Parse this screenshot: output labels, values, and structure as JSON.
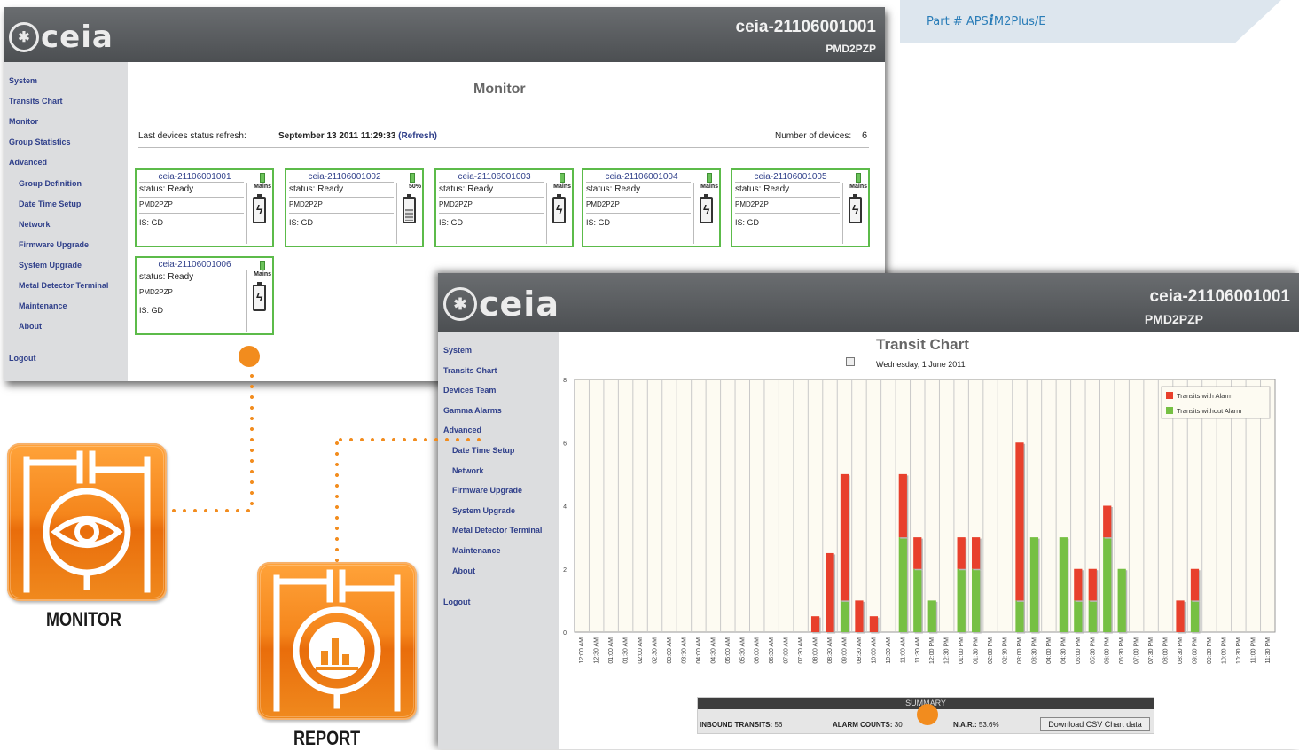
{
  "part_number": {
    "prefix": "Part # APS",
    "emphasis": "i",
    "suffix": "M2Plus/E"
  },
  "monitor_screen": {
    "brand": "ceia",
    "device_id": "ceia-21106001001",
    "model": "PMD2PZP",
    "sidebar": [
      "System",
      "Transits Chart",
      "Monitor",
      "Group Statistics",
      "Advanced",
      "Group Definition",
      "Date Time Setup",
      "Network",
      "Firmware Upgrade",
      "System Upgrade",
      "Metal Detector Terminal",
      "Maintenance",
      "About",
      "Logout"
    ],
    "title": "Monitor",
    "refresh_label": "Last devices status refresh:",
    "refresh_date": "September 13 2011 11:29:33",
    "refresh_link": "(Refresh)",
    "device_count_label": "Number of devices:",
    "device_count": "6",
    "devices": [
      {
        "name": "ceia-21106001001",
        "status": "status: Ready",
        "model": "PMD2PZP",
        "is": "IS: GD",
        "power": "Mains"
      },
      {
        "name": "ceia-21106001002",
        "status": "status: Ready",
        "model": "PMD2PZP",
        "is": "IS: GD",
        "power": "50%"
      },
      {
        "name": "ceia-21106001003",
        "status": "status: Ready",
        "model": "PMD2PZP",
        "is": "IS: GD",
        "power": "Mains"
      },
      {
        "name": "ceia-21106001004",
        "status": "status: Ready",
        "model": "PMD2PZP",
        "is": "IS: GD",
        "power": "Mains"
      },
      {
        "name": "ceia-21106001005",
        "status": "status: Ready",
        "model": "PMD2PZP",
        "is": "IS: GD",
        "power": "Mains"
      },
      {
        "name": "ceia-21106001006",
        "status": "status: Ready",
        "model": "PMD2PZP",
        "is": "IS: GD",
        "power": "Mains"
      }
    ]
  },
  "transit_screen": {
    "brand": "ceia",
    "device_id": "ceia-21106001001",
    "model": "PMD2PZP",
    "sidebar": [
      "System",
      "Transits Chart",
      "Devices Team",
      "Gamma Alarms",
      "Advanced",
      "Date Time Setup",
      "Network",
      "Firmware Upgrade",
      "System Upgrade",
      "Metal Detector Terminal",
      "Maintenance",
      "About",
      "Logout"
    ],
    "title": "Transit Chart",
    "date": "Wednesday, 1 June 2011",
    "summary": {
      "header": "SUMMARY",
      "inbound_label": "INBOUND TRANSITS:",
      "inbound_value": "56",
      "alarm_label": "ALARM COUNTS:",
      "alarm_value": "30",
      "nar_label": "N.A.R.:",
      "nar_value": "53.6%",
      "button": "Download CSV Chart data"
    }
  },
  "chart_data": {
    "type": "bar",
    "stacked": true,
    "title": "Transit Chart",
    "ylim": [
      0,
      8
    ],
    "yticks": [
      0,
      2,
      4,
      6,
      8
    ],
    "grid": true,
    "legend": "top-right",
    "colors": {
      "Transits with Alarm": "#e8402c",
      "Transits without Alarm": "#76c043"
    },
    "categories": [
      "12:00 AM",
      "12:30 AM",
      "01:00 AM",
      "01:30 AM",
      "02:00 AM",
      "02:30 AM",
      "03:00 AM",
      "03:30 AM",
      "04:00 AM",
      "04:30 AM",
      "05:00 AM",
      "05:30 AM",
      "06:00 AM",
      "06:30 AM",
      "07:00 AM",
      "07:30 AM",
      "08:00 AM",
      "08:30 AM",
      "09:00 AM",
      "09:30 AM",
      "10:00 AM",
      "10:30 AM",
      "11:00 AM",
      "11:30 AM",
      "12:00 PM",
      "12:30 PM",
      "01:00 PM",
      "01:30 PM",
      "02:00 PM",
      "02:30 PM",
      "03:00 PM",
      "03:30 PM",
      "04:00 PM",
      "04:30 PM",
      "05:00 PM",
      "05:30 PM",
      "06:00 PM",
      "06:30 PM",
      "07:00 PM",
      "07:30 PM",
      "08:00 PM",
      "08:30 PM",
      "09:00 PM",
      "09:30 PM",
      "10:00 PM",
      "10:30 PM",
      "11:00 PM",
      "11:30 PM"
    ],
    "series": [
      {
        "name": "Transits without Alarm",
        "values": [
          0,
          0,
          0,
          0,
          0,
          0,
          0,
          0,
          0,
          0,
          0,
          0,
          0,
          0,
          0,
          0,
          0,
          0,
          1,
          0,
          0,
          0,
          3,
          2,
          1,
          0,
          2,
          2,
          0,
          0,
          1,
          3,
          0,
          3,
          1,
          1,
          3,
          2,
          0,
          0,
          0,
          0,
          1,
          0,
          0,
          0,
          0,
          0
        ]
      },
      {
        "name": "Transits with Alarm",
        "values": [
          0,
          0,
          0,
          0,
          0,
          0,
          0,
          0,
          0,
          0,
          0,
          0,
          0,
          0,
          0,
          0,
          0.5,
          2.5,
          4,
          1,
          0.5,
          0,
          2,
          1,
          0,
          0,
          1,
          1,
          0,
          0,
          5,
          0,
          0,
          0,
          1,
          1,
          1,
          0,
          0,
          0,
          0,
          1,
          1,
          0,
          0,
          0,
          0,
          0
        ]
      }
    ]
  },
  "apps": [
    {
      "label": "MONITOR",
      "icon": "eye-icon"
    },
    {
      "label": "REPORT",
      "icon": "bar-chart-icon"
    }
  ]
}
